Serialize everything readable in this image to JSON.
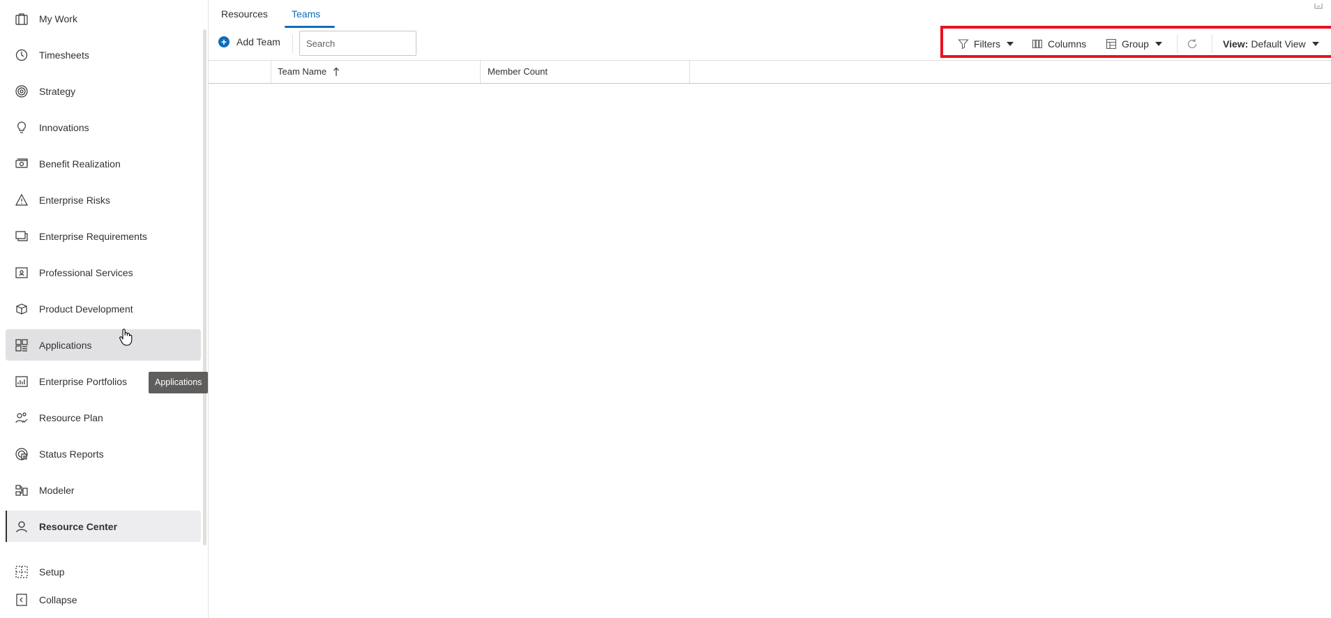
{
  "sidebar": {
    "items": [
      {
        "label": "My Work",
        "icon": "briefcase-icon"
      },
      {
        "label": "Timesheets",
        "icon": "clock-icon"
      },
      {
        "label": "Strategy",
        "icon": "target-icon"
      },
      {
        "label": "Innovations",
        "icon": "lightbulb-icon"
      },
      {
        "label": "Benefit Realization",
        "icon": "money-icon"
      },
      {
        "label": "Enterprise Risks",
        "icon": "warning-icon"
      },
      {
        "label": "Enterprise Requirements",
        "icon": "stacked-windows-icon"
      },
      {
        "label": "Professional Services",
        "icon": "contact-card-icon"
      },
      {
        "label": "Product Development",
        "icon": "box-icon"
      },
      {
        "label": "Applications",
        "icon": "apps-grid-icon"
      },
      {
        "label": "Enterprise Portfolios",
        "icon": "bar-chart-icon"
      },
      {
        "label": "Resource Plan",
        "icon": "people-check-icon"
      },
      {
        "label": "Status Reports",
        "icon": "radar-icon"
      },
      {
        "label": "Modeler",
        "icon": "diagram-icon"
      },
      {
        "label": "Resource Center",
        "icon": "person-icon"
      }
    ],
    "setup_label": "Setup",
    "collapse_label": "Collapse",
    "tooltip": "Applications"
  },
  "tabs": [
    {
      "label": "Resources"
    },
    {
      "label": "Teams"
    }
  ],
  "toolbar": {
    "add_team_label": "Add Team",
    "search_placeholder": "Search",
    "filters_label": "Filters",
    "columns_label": "Columns",
    "group_label": "Group",
    "view_prefix": "View:",
    "view_value": "Default View"
  },
  "grid": {
    "columns": [
      "Team Name",
      "Member Count"
    ],
    "sort_column": "Team Name",
    "sort_direction": "ascending"
  },
  "colors": {
    "accent": "#0f6cbd",
    "highlight_border": "#e81123"
  }
}
